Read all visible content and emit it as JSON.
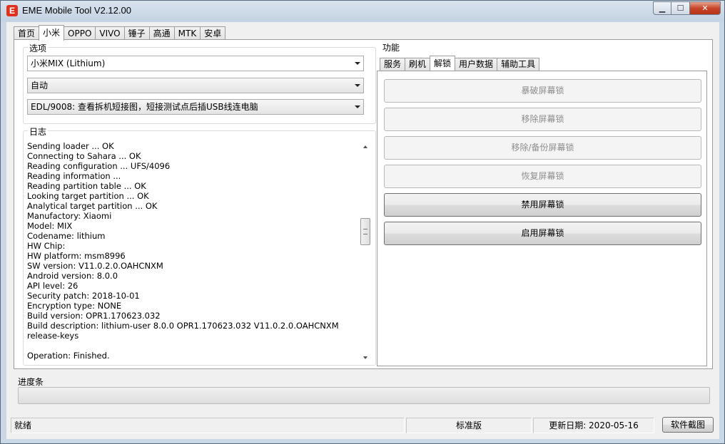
{
  "window": {
    "title": "EME Mobile Tool V2.12.00",
    "icon_letter": "E",
    "controls": {
      "minimize": "▁",
      "maximize": "☐",
      "close": "✕"
    }
  },
  "main_tabs": [
    {
      "label": "首页",
      "active": false
    },
    {
      "label": "小米",
      "active": true
    },
    {
      "label": "OPPO",
      "active": false
    },
    {
      "label": "VIVO",
      "active": false
    },
    {
      "label": "锤子",
      "active": false
    },
    {
      "label": "高通",
      "active": false
    },
    {
      "label": "MTK",
      "active": false
    },
    {
      "label": "安卓",
      "active": false
    }
  ],
  "options": {
    "label": "选项",
    "model_select": "小米MIX (Lithium)",
    "mode_select": "自动",
    "port_select": "EDL/9008: 查看拆机短接图，短接测试点后插USB线连电脑"
  },
  "log": {
    "label": "日志",
    "lines": [
      "Sending loader ... OK",
      "Connecting to Sahara ... OK",
      "Reading configuration ... UFS/4096",
      "Reading information ...",
      "Reading partition table ... OK",
      "Looking target partition ... OK",
      "Analytical target partition ... OK",
      "Manufactory: Xiaomi",
      "Model: MIX",
      "Codename: lithium",
      "HW Chip:",
      "HW platform: msm8996",
      "SW version: V11.0.2.0.OAHCNXM",
      "Android version: 8.0.0",
      "API level: 26",
      "Security patch: 2018-10-01",
      "Encryption type: NONE",
      "Build version: OPR1.170623.032",
      "Build description: lithium-user 8.0.0 OPR1.170623.032 V11.0.2.0.OAHCNXM",
      "release-keys",
      "",
      "Operation: Finished."
    ]
  },
  "functions": {
    "label": "功能",
    "tabs": [
      {
        "label": "服务",
        "active": false
      },
      {
        "label": "刷机",
        "active": false
      },
      {
        "label": "解锁",
        "active": true
      },
      {
        "label": "用户数据",
        "active": false
      },
      {
        "label": "辅助工具",
        "active": false
      }
    ],
    "buttons": [
      {
        "label": "暴破屏幕锁",
        "enabled": false
      },
      {
        "label": "移除屏幕锁",
        "enabled": false
      },
      {
        "label": "移除/备份屏幕锁",
        "enabled": false
      },
      {
        "label": "恢复屏幕锁",
        "enabled": false
      },
      {
        "label": "禁用屏幕锁",
        "enabled": true
      },
      {
        "label": "启用屏幕锁",
        "enabled": true
      }
    ]
  },
  "progress": {
    "label": "进度条",
    "value_percent": 0
  },
  "status": {
    "state": "就绪",
    "edition": "标准版",
    "update_date": "更新日期:  2020-05-16",
    "screenshot_button": "软件截图"
  }
}
